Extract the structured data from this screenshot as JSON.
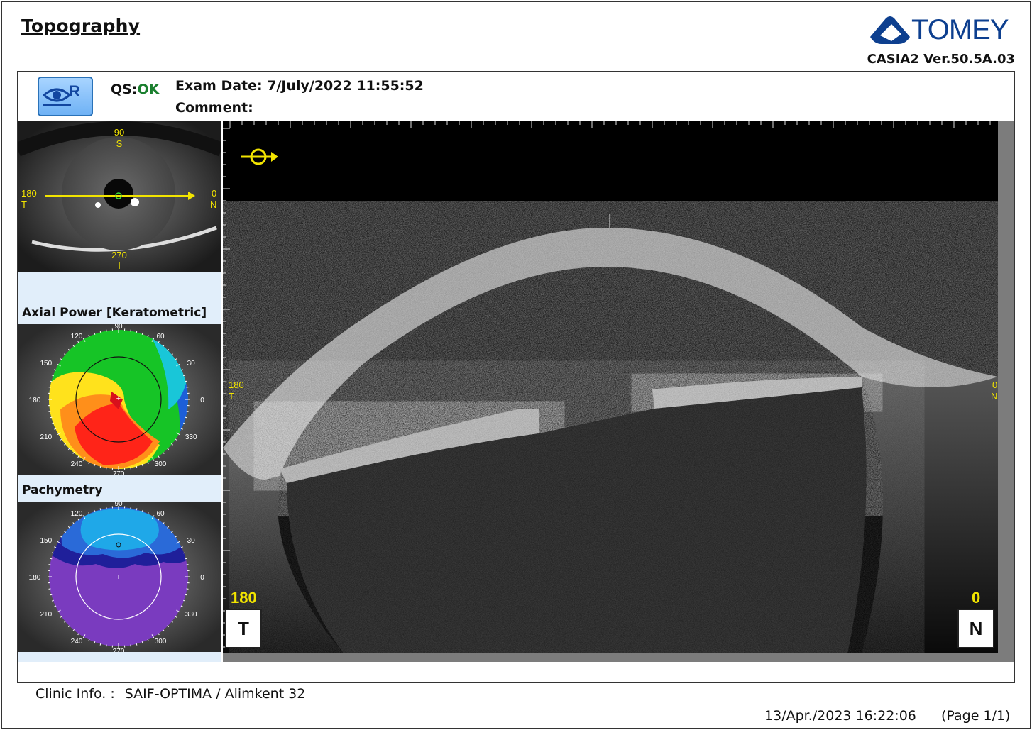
{
  "report": {
    "title": "Topography",
    "brand": "TOMEY",
    "version": "CASIA2 Ver.50.5A.03"
  },
  "header": {
    "eye": "R",
    "qs_label": "QS:",
    "qs_value": "OK",
    "exam_date": "Exam Date: 7/July/2022 11:55:52",
    "comment": "Comment:"
  },
  "eye_photo": {
    "top_deg": "90",
    "top_dir": "S",
    "left_deg": "180",
    "left_dir": "T",
    "right_deg": "0",
    "right_dir": "N",
    "bottom_deg": "270",
    "bottom_dir": "I"
  },
  "maps": [
    {
      "title": "Axial Power [Keratometric]"
    },
    {
      "title": "Pachymetry"
    }
  ],
  "map_angles": [
    "90",
    "60",
    "30",
    "0",
    "330",
    "300",
    "270",
    "240",
    "210",
    "180",
    "150",
    "120"
  ],
  "oct": {
    "left_label_deg": "180",
    "left_label_dir": "T",
    "right_label_deg": "0",
    "right_label_dir": "N",
    "corner_left_num": "180",
    "corner_left_letter": "T",
    "corner_right_num": "0",
    "corner_right_letter": "N"
  },
  "footer": {
    "clinic_label": "Clinic Info. :",
    "clinic_value": "SAIF-OPTIMA / Alimkent 32",
    "printed": "13/Apr./2023 16:22:06",
    "page": "(Page 1/1)"
  },
  "colors": {
    "brand": "#0d3f8f",
    "qs_ok": "#1a7f2e",
    "overlay_yellow": "#f2e400"
  }
}
